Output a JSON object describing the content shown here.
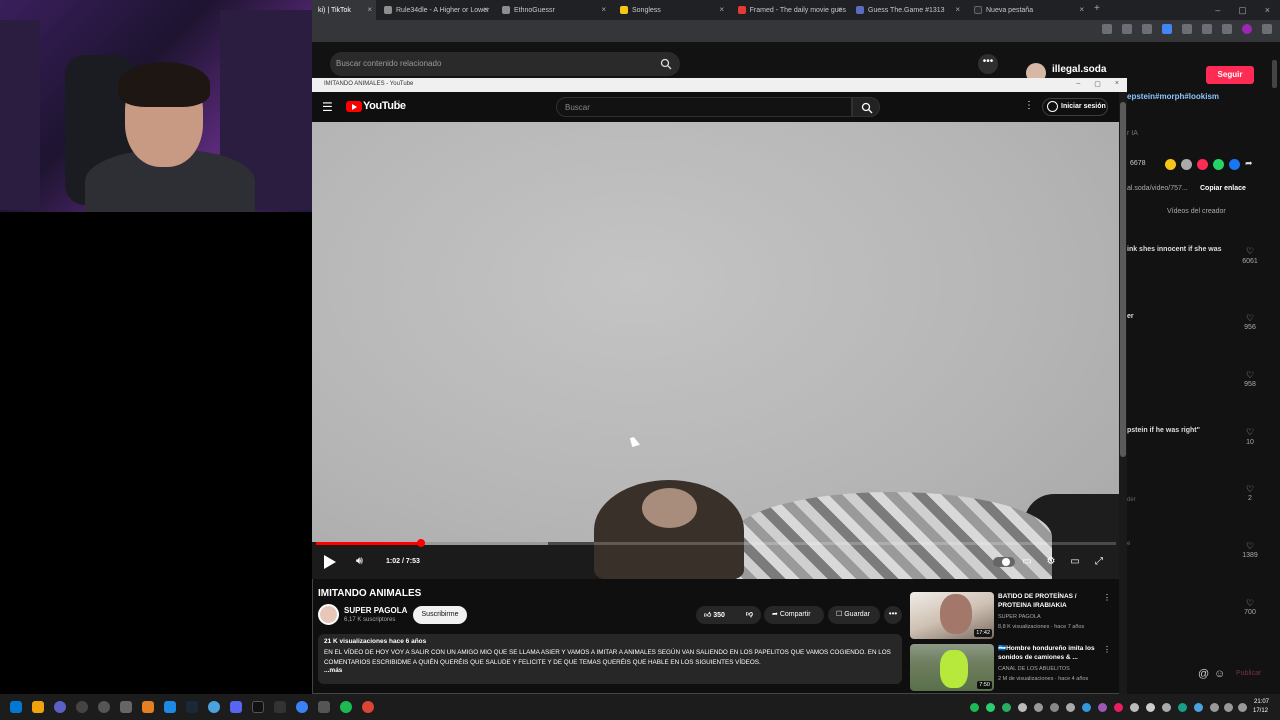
{
  "browser": {
    "tabs": [
      {
        "label": "ki) | TikTok",
        "color": "#000000",
        "active": true
      },
      {
        "label": "Rule34dle - A Higher or Lower",
        "color": "#8e8e8e"
      },
      {
        "label": "EthnoGuessr",
        "color": "#8e8e8e"
      },
      {
        "label": "Songless",
        "color": "#f5c518"
      },
      {
        "label": "Framed - The daily movie gues",
        "color": "#e53935"
      },
      {
        "label": "Guess The.Game #1313",
        "color": "#5c6bc0"
      },
      {
        "label": "Nueva pestaña",
        "color": "#2b2b2b"
      }
    ],
    "close_glyph": "×",
    "new_tab_glyph": "+",
    "window_controls": [
      "–",
      "▢",
      "×"
    ]
  },
  "tiktok": {
    "search_placeholder": "Buscar contenido relacionado",
    "more_glyph": "•••",
    "username": "illegal.soda",
    "follow_label": "Seguir",
    "tags": "epstein#morph#lookism",
    "ai_label": "r IA",
    "share_count": "6678",
    "link_text": "al.soda/video/757...",
    "copy_link_label": "Copiar enlace",
    "creator_videos_label": "Vídeos del creador",
    "comments": [
      {
        "text": "ink shes innocent if she was",
        "likes": "6061"
      },
      {
        "text": "er",
        "likes": "956"
      },
      {
        "text": "",
        "likes": "958"
      },
      {
        "text": "pstein if he was right\"",
        "likes": "10"
      },
      {
        "text": "",
        "likes": "2"
      },
      {
        "text": "",
        "likes": "1389"
      },
      {
        "text": "",
        "likes": "700"
      }
    ],
    "reply_label_1": "der",
    "reply_label_2": "e",
    "publish_label": "Publicar",
    "heart_glyph": "♡"
  },
  "youtube": {
    "window_title": "IMITANDO ANIMALES - YouTube",
    "logo_text": "YouTube",
    "logo_region": "ES",
    "search_placeholder": "Buscar",
    "signin_label": "Iniciar sesión",
    "player": {
      "time": "1:02 / 7:53",
      "progress_fraction": 0.1317,
      "buffered_fraction": 0.29
    },
    "video_title": "IMITANDO ANIMALES",
    "channel_name": "SUPER PAGOLA",
    "channel_subs": "6,17 K suscriptores",
    "subscribe_label": "Suscribirme",
    "like_count": "350",
    "share_label": "Compartir",
    "save_label": "Guardar",
    "description": {
      "meta": "21 K visualizaciones  hace 6 años",
      "text": "EN EL VÍDEO DE HOY VOY A SALIR CON UN AMIGO MIO QUE SE LLAMA ASIER Y VAMOS A IMITAR A ANIMALES SEGÚN VAN SALIENDO EN LOS PAPELITOS QUE VAMOS COGIENDO. EN LOS COMENTARIOS ESCRIBIDME A QUIÉN QUERÉIS QUE SALUDE Y FELICITE Y DE QUE TEMAS QUERÉIS QUE HABLE EN LOS SIGUIENTES VÍDEOS.",
      "more": "...más"
    },
    "recommendations": [
      {
        "title": "BATIDO DE PROTEÍNAS / PROTEINA IRABIAKIA",
        "channel": "SUPER PAGOLA",
        "meta": "8,8 K visualizaciones · hace 7 años",
        "duration": "17:42"
      },
      {
        "title": "🇭🇳Hombre hondureño imita  los sonidos de camiones & ...",
        "channel": "CANAL DE LOS ABUELITOS",
        "meta": "2 M de visualizaciones · hace 4 años",
        "duration": "7:50"
      }
    ]
  },
  "taskbar": {
    "time": "21:07",
    "date": "17/12"
  }
}
